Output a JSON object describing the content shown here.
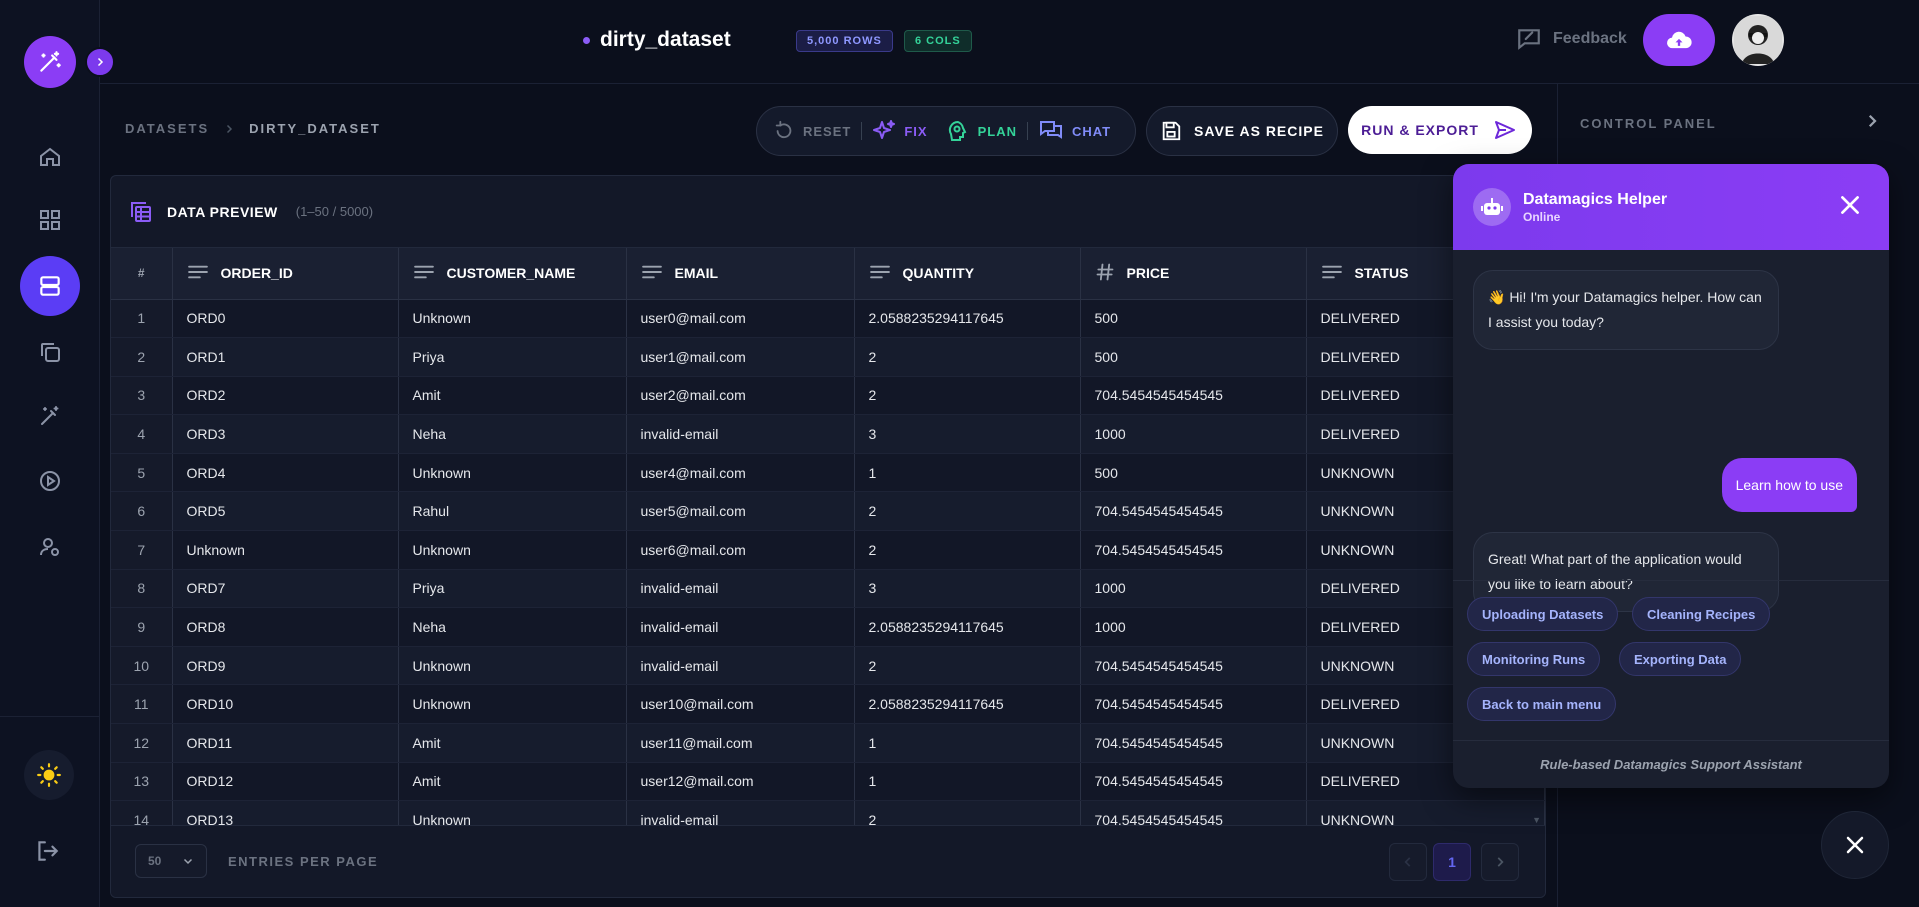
{
  "header": {
    "dataset_name": "dirty_dataset",
    "rows_badge": "5,000 ROWS",
    "cols_badge": "6 COLS",
    "feedback_label": "Feedback"
  },
  "breadcrumb": {
    "root": "DATASETS",
    "current": "DIRTY_DATASET"
  },
  "actions": {
    "reset": "RESET",
    "fix": "FIX",
    "plan": "PLAN",
    "chat": "CHAT",
    "save_recipe": "SAVE AS RECIPE",
    "run_export": "RUN & EXPORT"
  },
  "colors": {
    "accent": "#8b3df5",
    "fix": "#8b5cf6",
    "plan": "#34d399",
    "chat": "#818cf8",
    "reset": "#6b7280"
  },
  "control_panel": {
    "title": "CONTROL PANEL"
  },
  "preview": {
    "title": "DATA PREVIEW",
    "range": "(1–50 / 5000)",
    "columns": [
      {
        "label": "#",
        "icon": "hash-col-icon"
      },
      {
        "label": "ORDER_ID",
        "icon": "text-type-icon"
      },
      {
        "label": "CUSTOMER_NAME",
        "icon": "text-type-icon"
      },
      {
        "label": "EMAIL",
        "icon": "text-type-icon"
      },
      {
        "label": "QUANTITY",
        "icon": "text-type-icon"
      },
      {
        "label": "PRICE",
        "icon": "number-type-icon"
      },
      {
        "label": "STATUS",
        "icon": "text-type-icon"
      }
    ],
    "rows": [
      [
        "1",
        "ORD0",
        "Unknown",
        "user0@mail.com",
        "2.0588235294117645",
        "500",
        "DELIVERED"
      ],
      [
        "2",
        "ORD1",
        "Priya",
        "user1@mail.com",
        "2",
        "500",
        "DELIVERED"
      ],
      [
        "3",
        "ORD2",
        "Amit",
        "user2@mail.com",
        "2",
        "704.5454545454545",
        "DELIVERED"
      ],
      [
        "4",
        "ORD3",
        "Neha",
        "invalid-email",
        "3",
        "1000",
        "DELIVERED"
      ],
      [
        "5",
        "ORD4",
        "Unknown",
        "user4@mail.com",
        "1",
        "500",
        "UNKNOWN"
      ],
      [
        "6",
        "ORD5",
        "Rahul",
        "user5@mail.com",
        "2",
        "704.5454545454545",
        "UNKNOWN"
      ],
      [
        "7",
        "Unknown",
        "Unknown",
        "user6@mail.com",
        "2",
        "704.5454545454545",
        "UNKNOWN"
      ],
      [
        "8",
        "ORD7",
        "Priya",
        "invalid-email",
        "3",
        "1000",
        "DELIVERED"
      ],
      [
        "9",
        "ORD8",
        "Neha",
        "invalid-email",
        "2.0588235294117645",
        "1000",
        "DELIVERED"
      ],
      [
        "10",
        "ORD9",
        "Unknown",
        "invalid-email",
        "2",
        "704.5454545454545",
        "UNKNOWN"
      ],
      [
        "11",
        "ORD10",
        "Unknown",
        "user10@mail.com",
        "2.0588235294117645",
        "704.5454545454545",
        "DELIVERED"
      ],
      [
        "12",
        "ORD11",
        "Amit",
        "user11@mail.com",
        "1",
        "704.5454545454545",
        "UNKNOWN"
      ],
      [
        "13",
        "ORD12",
        "Amit",
        "user12@mail.com",
        "1",
        "704.5454545454545",
        "DELIVERED"
      ],
      [
        "14",
        "ORD13",
        "Unknown",
        "invalid-email",
        "2",
        "704.5454545454545",
        "UNKNOWN"
      ]
    ],
    "per_page_value": "50",
    "per_page_label": "ENTRIES PER PAGE",
    "current_page": "1"
  },
  "chat": {
    "name": "Datamagics Helper",
    "status": "Online",
    "messages": [
      {
        "from": "bot",
        "text": "👋 Hi! I'm your Datamagics helper. How can I assist you today?"
      },
      {
        "from": "user",
        "text": "Learn how to use"
      },
      {
        "from": "bot",
        "text": "Great! What part of the application would you like to learn about?"
      }
    ],
    "options": [
      "Uploading Datasets",
      "Cleaning Recipes",
      "Monitoring Runs",
      "Exporting Data",
      "Back to main menu"
    ],
    "footer": "Rule-based Datamagics Support Assistant"
  }
}
